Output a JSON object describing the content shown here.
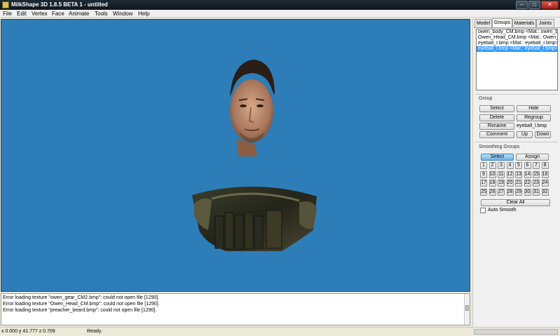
{
  "window": {
    "title": "MilkShape 3D 1.8.5 BETA 1 - untitled"
  },
  "menu": [
    "File",
    "Edit",
    "Vertex",
    "Face",
    "Animate",
    "Tools",
    "Window",
    "Help"
  ],
  "tabs": [
    "Model",
    "Groups",
    "Materials",
    "Joints"
  ],
  "active_tab": "Groups",
  "groups": {
    "items": [
      "owen_body_CM.bmp <Mat.: owen_body",
      "Owen_Head_CM.bmp <Mat.: Owen_Hea",
      "eyeball_r.bmp <Mat.: eyeball_r.bmp>",
      "eyeball_l.bmp <Mat.: eyeball_l.bmp>"
    ],
    "selected_index": 3
  },
  "group_section": {
    "label": "Group",
    "select": "Select",
    "hide": "Hide",
    "delete": "Delete",
    "regroup": "Regroup",
    "rename": "Rename",
    "group_name": "eyeball_l.bmp",
    "comment": "Comment",
    "up": "Up",
    "down": "Down"
  },
  "smoothing": {
    "label": "Smoothing Groups",
    "select": "Select",
    "assign": "Assign",
    "numbers": [
      "1",
      "2",
      "3",
      "4",
      "5",
      "6",
      "7",
      "8",
      "9",
      "10",
      "11",
      "12",
      "13",
      "14",
      "15",
      "16",
      "17",
      "18",
      "19",
      "20",
      "21",
      "22",
      "23",
      "24",
      "25",
      "26",
      "27",
      "28",
      "29",
      "30",
      "31",
      "32"
    ],
    "clear_all": "Clear All",
    "auto_smooth": "Auto Smooth"
  },
  "console": [
    "Error loading texture \"owen_gear_CM2.bmp\": could not open file [1290].",
    "Error loading texture \"Owen_Head_CM.bmp\": could not open file [1290].",
    "Error loading texture \"preacher_beard.bmp\": could not open file [1290]."
  ],
  "status": {
    "coords": "x 0.000 y 41.777 z 0.709",
    "message": "Ready."
  },
  "colors": {
    "viewport": "#2d7db8",
    "selection": "#3399ff"
  },
  "icons": {
    "app": "milkshape-app-icon"
  }
}
